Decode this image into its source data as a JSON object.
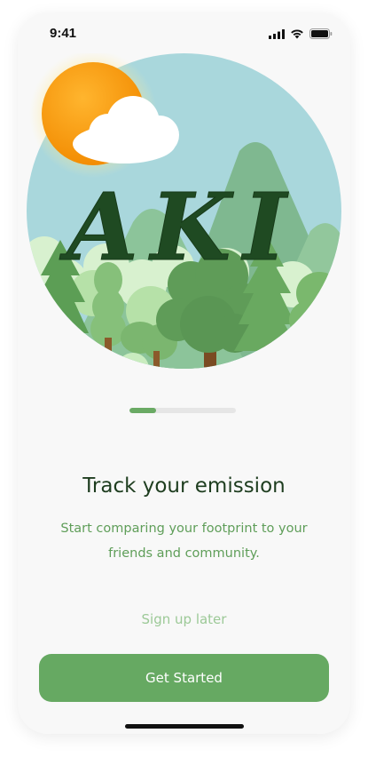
{
  "status_bar": {
    "time": "9:41",
    "icons": [
      "cellular-signal-icon",
      "wifi-icon",
      "battery-icon"
    ]
  },
  "hero": {
    "logo_text": "AKI"
  },
  "progress": {
    "fraction": 0.25
  },
  "onboarding": {
    "title": "Track your emission",
    "subtitle": "Start comparing your footprint to your friends and community."
  },
  "actions": {
    "sign_up_later": "Sign up later",
    "get_started": "Get Started"
  },
  "colors": {
    "primary_green": "#66a962",
    "title_dark_green": "#1e3d1f",
    "subtitle_green": "#5f9e59",
    "link_light_green": "#9cc997",
    "sky": "#a9d7dc",
    "sun": "#f59a0d"
  }
}
